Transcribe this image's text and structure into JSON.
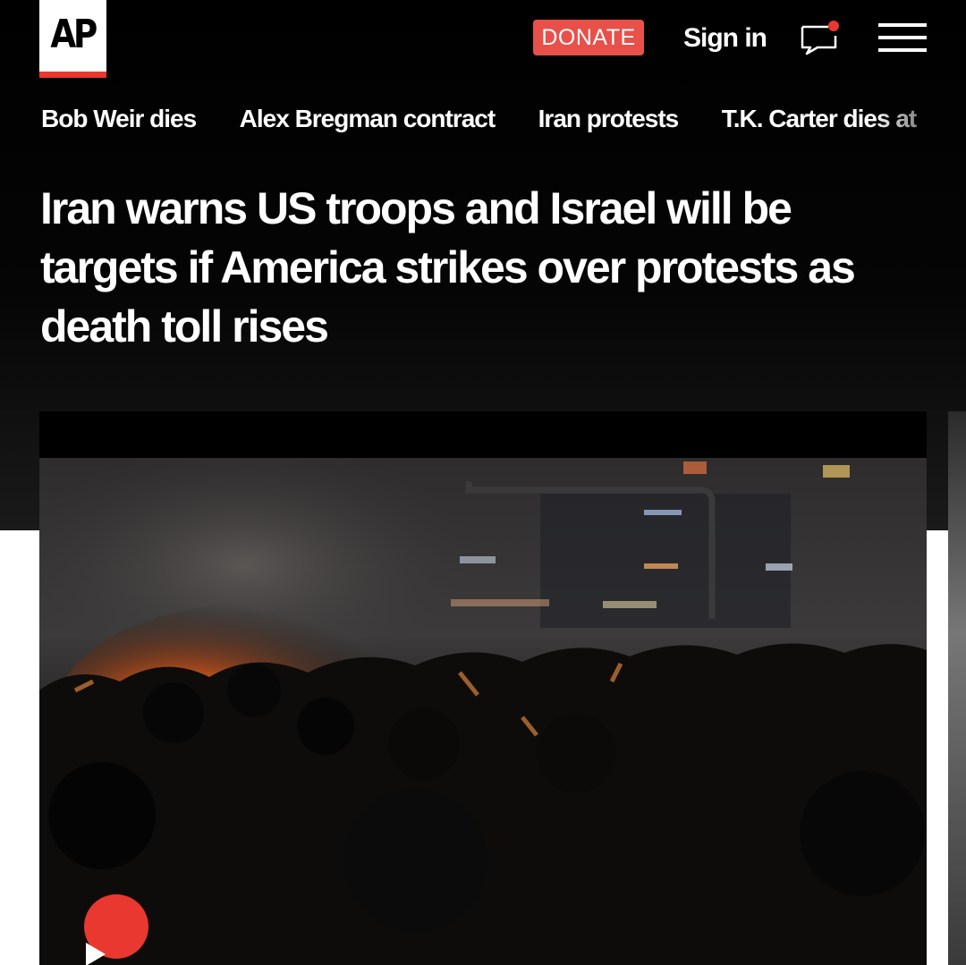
{
  "header": {
    "logo_text": "AP",
    "donate_label": "DONATE",
    "signin_label": "Sign in",
    "icons": [
      "chat-notification-icon",
      "hamburger-menu-icon"
    ]
  },
  "trending": [
    "Bob Weir dies",
    "Alex Bregman contract",
    "Iran protests",
    "T.K. Carter dies at"
  ],
  "article": {
    "headline": "Iran warns US troops and Israel will be targets if America strikes over protests as death toll rises"
  },
  "video": {
    "play_icon": "play-icon"
  },
  "colors": {
    "accent": "#e8382f",
    "donate": "#e8504a",
    "background": "#000000"
  }
}
